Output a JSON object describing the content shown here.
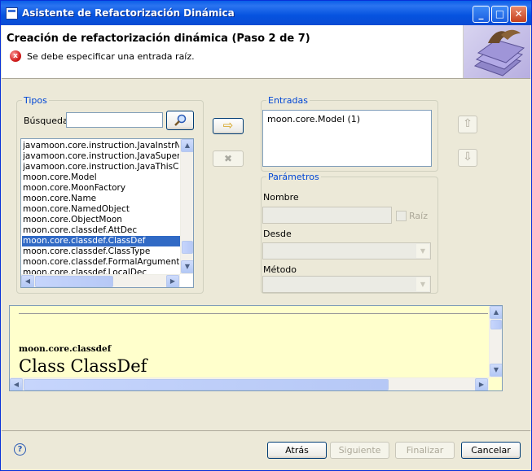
{
  "window": {
    "title": "Asistente de Refactorización Dinámica",
    "minimize_glyph": "_",
    "maximize_glyph": "□",
    "close_glyph": "✕"
  },
  "header": {
    "step_title": "Creación de refactorización dinámica (Paso 2 de 7)",
    "error_icon_glyph": "x",
    "error_message": "Se debe especificar una entrada raíz."
  },
  "tipos": {
    "group_label": "Tipos",
    "search_label": "Búsqueda:",
    "search_value": "",
    "search_icon": "magnifier-icon",
    "items": [
      "javamoon.core.instruction.JavaInstrNoM",
      "javamoon.core.instruction.JavaSuperCo",
      "javamoon.core.instruction.JavaThisCon",
      "moon.core.Model",
      "moon.core.MoonFactory",
      "moon.core.Name",
      "moon.core.NamedObject",
      "moon.core.ObjectMoon",
      "moon.core.classdef.AttDec",
      "moon.core.classdef.ClassDef",
      "moon.core.classdef.ClassType",
      "moon.core.classdef.FormalArgument",
      "moon.core.classdef.LocalDec"
    ],
    "selected_item": "moon.core.classdef.ClassDef"
  },
  "transfer": {
    "add_icon": "right-arrow-icon",
    "add_glyph": "⇨",
    "remove_icon": "remove-x-icon",
    "remove_glyph": "✖"
  },
  "entradas": {
    "group_label": "Entradas",
    "items": [
      "moon.core.Model (1)"
    ],
    "up_glyph": "⇧",
    "down_glyph": "⇩"
  },
  "parametros": {
    "group_label": "Parámetros",
    "nombre_label": "Nombre",
    "nombre_value": "",
    "raiz_label": "Raíz",
    "raiz_checked": false,
    "desde_label": "Desde",
    "desde_value": "",
    "metodo_label": "Método",
    "metodo_value": ""
  },
  "doc": {
    "package": "moon.core.classdef",
    "class_title": "Class ClassDef"
  },
  "footer": {
    "help_glyph": "?",
    "back_label": "Atrás",
    "next_label": "Siguiente",
    "finish_label": "Finalizar",
    "cancel_label": "Cancelar"
  }
}
